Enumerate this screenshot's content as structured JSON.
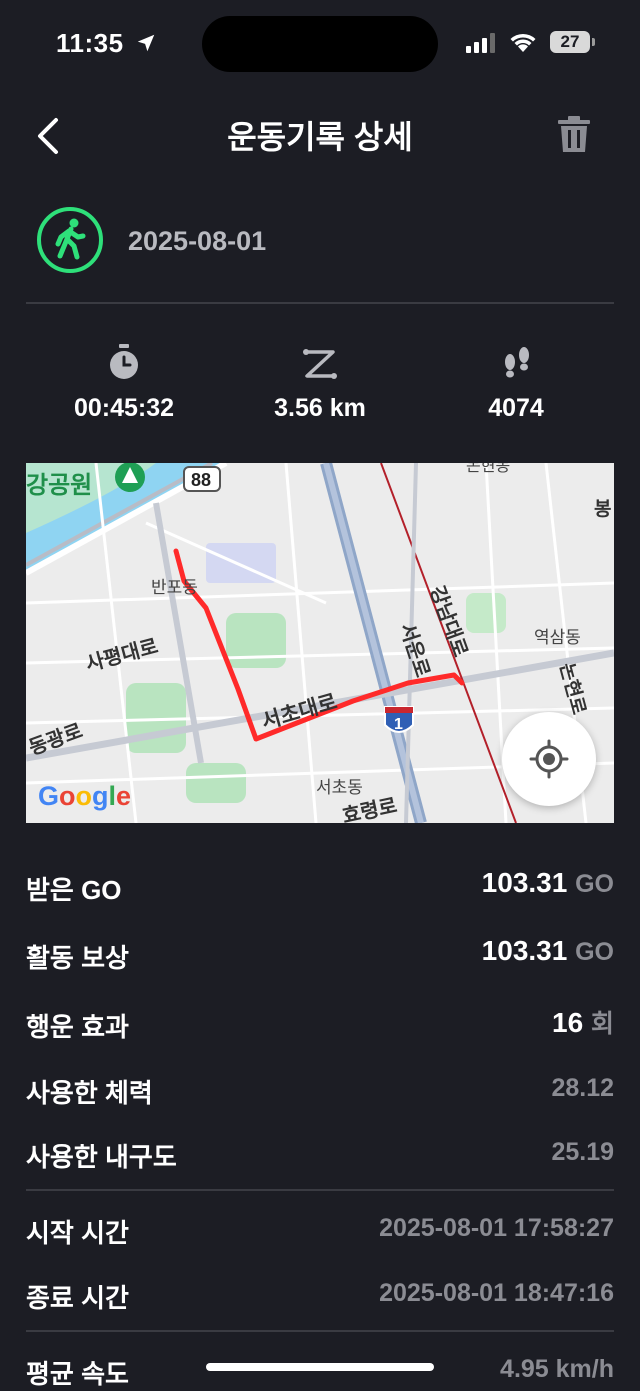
{
  "status_bar": {
    "time": "11:35",
    "battery": "27"
  },
  "header": {
    "title": "운동기록 상세"
  },
  "activity": {
    "date": "2025-08-01"
  },
  "stats": {
    "duration": "00:45:32",
    "distance": "3.56 km",
    "steps": "4074"
  },
  "map": {
    "logo": "Google",
    "route_color": "#ff2a2a",
    "labels": {
      "park": "강공원",
      "route_num": "88",
      "banpo": "반포동",
      "sapyeong": "사평대로",
      "seocho_daero": "서초대로",
      "seoun": "서운로",
      "gangnam": "강남대로",
      "yeoksam": "역삼동",
      "nonhyeon": "논현로",
      "donggwang": "동광로",
      "seocho_dong": "서초동",
      "hyoryeong": "효령로",
      "highway": "1",
      "nonhyeon_dong": "논현동",
      "bong": "봉"
    }
  },
  "rows": {
    "received_go": {
      "label": "받은 GO",
      "value": "103.31",
      "unit": "GO"
    },
    "activity_reward": {
      "label": "활동 보상",
      "value": "103.31",
      "unit": "GO"
    },
    "luck_effect": {
      "label": "행운 효과",
      "value": "16",
      "unit": "회"
    },
    "stamina_used": {
      "label": "사용한 체력",
      "value": "28.12"
    },
    "durability_used": {
      "label": "사용한 내구도",
      "value": "25.19"
    },
    "start_time": {
      "label": "시작 시간",
      "value": "2025-08-01 17:58:27"
    },
    "end_time": {
      "label": "종료 시간",
      "value": "2025-08-01 18:47:16"
    },
    "avg_speed": {
      "label": "평균 속도",
      "value": "4.95 km/h"
    }
  },
  "colors": {
    "background": "#1c1d24",
    "accent": "#2ee07a",
    "muted": "#8b8c93"
  }
}
